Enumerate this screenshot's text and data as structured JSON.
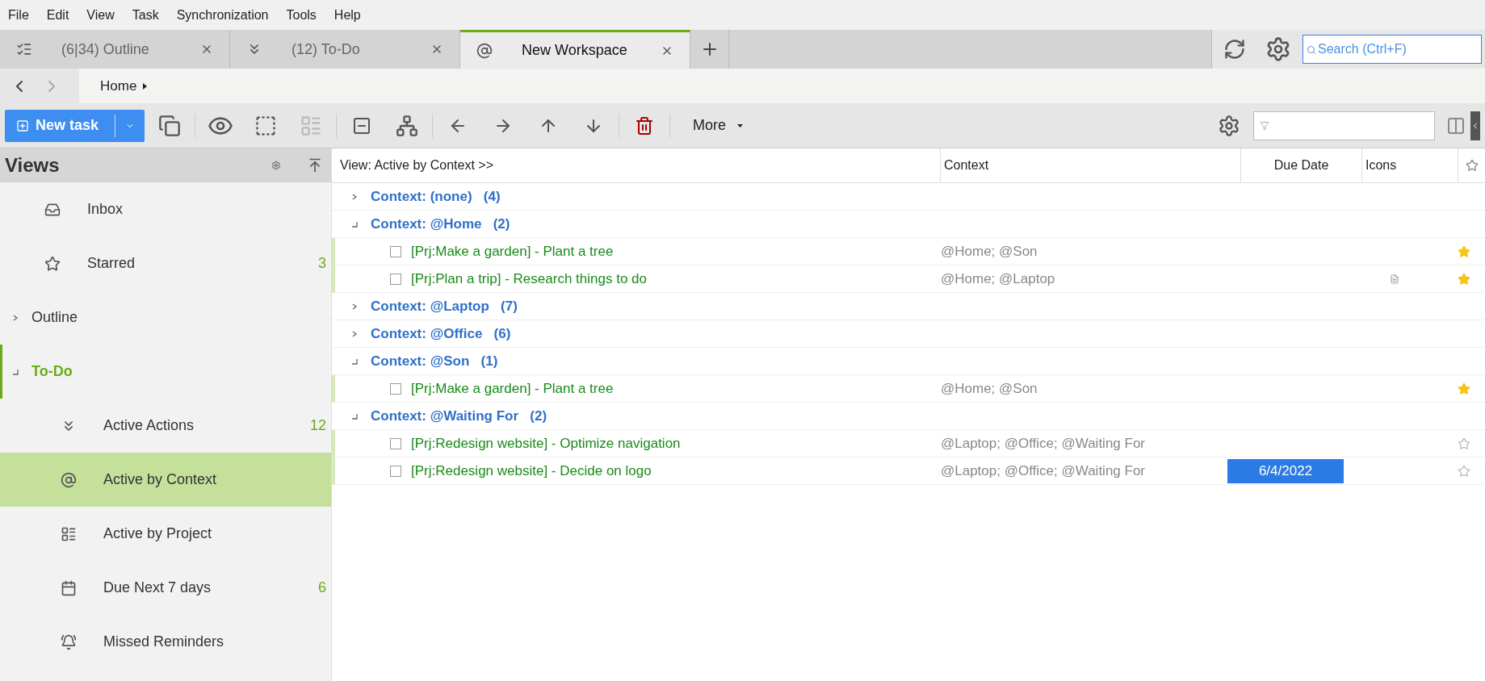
{
  "menu": [
    "File",
    "Edit",
    "View",
    "Task",
    "Synchronization",
    "Tools",
    "Help"
  ],
  "tabs": [
    {
      "label": "(6|34) Outline",
      "selected": false
    },
    {
      "label": "(12) To-Do",
      "selected": false
    },
    {
      "label": "New Workspace",
      "selected": true
    }
  ],
  "search": {
    "placeholder": "Search (Ctrl+F)"
  },
  "breadcrumb": [
    "Home"
  ],
  "toolbar": {
    "new_task": "New task",
    "more": "More"
  },
  "sidebar": {
    "title": "Views",
    "items": [
      {
        "label": "Inbox",
        "selected": false
      },
      {
        "label": "Starred",
        "count": "3",
        "selected": false
      },
      {
        "label": "Outline",
        "kind": "folder",
        "expanded": false,
        "selected": false,
        "active": false
      },
      {
        "label": "To-Do",
        "kind": "folder",
        "expanded": true,
        "selected": false,
        "active": true,
        "children": [
          {
            "label": "Active Actions",
            "count": "12",
            "selected": false
          },
          {
            "label": "Active by Context",
            "selected": true
          },
          {
            "label": "Active by Project",
            "selected": false
          },
          {
            "label": "Due Next 7 days",
            "count": "6",
            "selected": false
          },
          {
            "label": "Missed Reminders",
            "selected": false
          }
        ]
      }
    ]
  },
  "table": {
    "columns": [
      "View: Active by Context >>",
      "Context",
      "Due Date",
      "Icons"
    ],
    "rows": [
      {
        "kind": "group",
        "label": "Context: (none)   (4)",
        "expanded": false
      },
      {
        "kind": "group",
        "label": "Context: @Home   (2)",
        "expanded": true
      },
      {
        "kind": "task",
        "title": "[Prj:Make a garden] - Plant a tree",
        "context": "@Home; @Son",
        "note": false,
        "starred": true,
        "checked": false
      },
      {
        "kind": "task",
        "title": "[Prj:Plan a trip] - Research things to do",
        "context": "@Home; @Laptop",
        "note": true,
        "starred": true,
        "checked": false
      },
      {
        "kind": "group",
        "label": "Context: @Laptop   (7)",
        "expanded": false
      },
      {
        "kind": "group",
        "label": "Context: @Office   (6)",
        "expanded": false
      },
      {
        "kind": "group",
        "label": "Context: @Son   (1)",
        "expanded": true
      },
      {
        "kind": "task",
        "title": "[Prj:Make a garden] - Plant a tree",
        "context": "@Home; @Son",
        "note": false,
        "starred": true,
        "checked": false
      },
      {
        "kind": "group",
        "label": "Context: @Waiting For   (2)",
        "expanded": true
      },
      {
        "kind": "task",
        "title": "[Prj:Redesign website] - Optimize navigation",
        "context": "@Laptop; @Office; @Waiting For",
        "note": false,
        "starred": false,
        "checked": false
      },
      {
        "kind": "task",
        "title": "[Prj:Redesign website] - Decide on logo",
        "context": "@Laptop; @Office; @Waiting For",
        "due": "6/4/2022",
        "note": false,
        "starred": false,
        "checked": false
      }
    ]
  }
}
